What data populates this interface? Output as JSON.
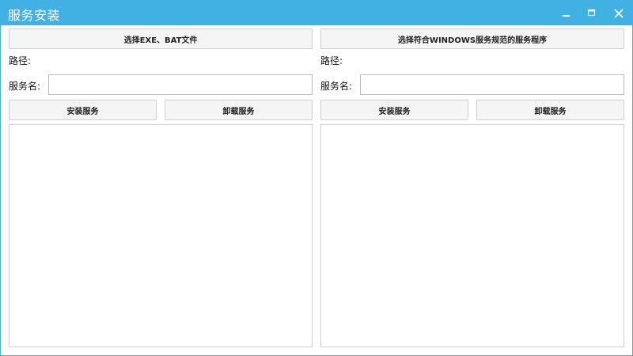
{
  "window": {
    "title": "服务安装"
  },
  "left": {
    "select_button": "选择EXE、BAT文件",
    "path_label": "路径:",
    "service_name_label": "服务名:",
    "service_name_value": "",
    "install_button": "安装服务",
    "uninstall_button": "卸载服务",
    "log_text": ""
  },
  "right": {
    "select_button": "选择符合WINDOWS服务规范的服务程序",
    "path_label": "路径:",
    "service_name_label": "服务名:",
    "service_name_value": "",
    "install_button": "安装服务",
    "uninstall_button": "卸载服务",
    "log_text": ""
  },
  "colors": {
    "titlebar": "#41b0e2",
    "button_bg": "#f5f5f5"
  },
  "icons": {
    "minimize": "minimize-icon",
    "maximize": "maximize-icon",
    "close": "close-icon"
  }
}
